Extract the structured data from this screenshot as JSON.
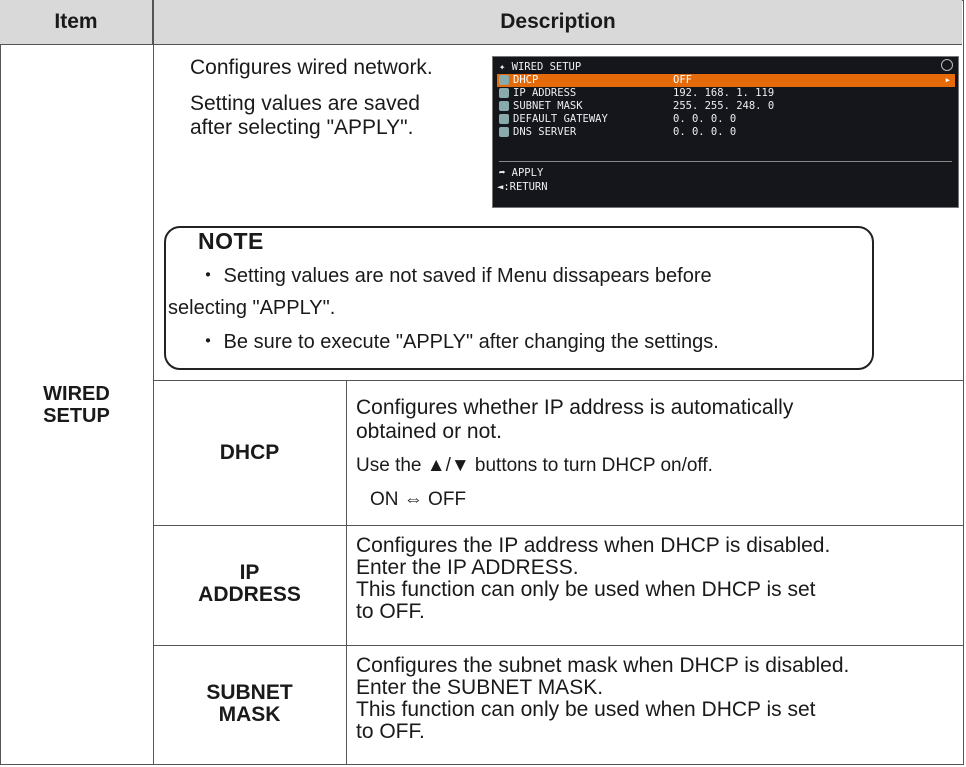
{
  "table": {
    "header": {
      "item": "Item",
      "description": "Description"
    },
    "section_item": "WIRED SETUP",
    "intro": {
      "line1": "Configures wired network.",
      "line2": "Setting values are saved",
      "line3": "after selecting \"APPLY\"."
    },
    "menu": {
      "title": "WIRED SETUP",
      "rows": [
        {
          "label": "DHCP",
          "value": "OFF",
          "selected": true
        },
        {
          "label": "IP ADDRESS",
          "value": "192. 168. 1. 119"
        },
        {
          "label": "SUBNET MASK",
          "value": "255. 255. 248. 0"
        },
        {
          "label": "DEFAULT GATEWAY",
          "value": "0. 0. 0. 0"
        },
        {
          "label": "DNS SERVER",
          "value": "0. 0. 0. 0"
        }
      ],
      "apply": "APPLY",
      "return": "◄:RETURN",
      "selected_color": "#e46a0a"
    },
    "note": {
      "title": "NOTE",
      "line1": "・ Setting values are not saved if Menu dissapears before",
      "line2": "selecting \"APPLY\".",
      "line3": "・ Be sure to execute \"APPLY\" after changing the settings."
    },
    "rows": [
      {
        "name": "DHCP",
        "line1": "Configures whether IP address is automatically",
        "line2": "obtained or not.",
        "line3": "Use the ▲/▼ buttons to turn DHCP on/off.",
        "line4": "ON ⇔ OFF"
      },
      {
        "name_line1": "IP",
        "name_line2": "ADDRESS",
        "line1": "Configures the IP address when DHCP is disabled.",
        "line2": "Enter the IP ADDRESS.",
        "line3": "This function can only be used when DHCP is set",
        "line4": "to OFF."
      },
      {
        "name_line1": "SUBNET",
        "name_line2": "MASK",
        "line1": "Configures the subnet mask when DHCP is disabled.",
        "line2": "Enter the SUBNET MASK.",
        "line3": "This function can only be used when DHCP is set",
        "line4": "to OFF."
      }
    ]
  }
}
